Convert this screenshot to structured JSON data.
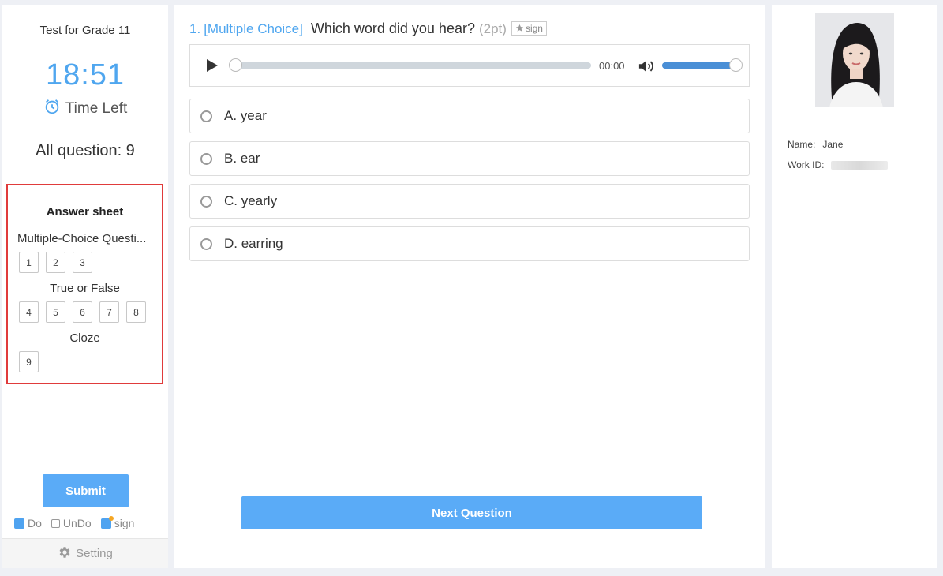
{
  "left": {
    "exam_title": "Test for Grade 11",
    "timer": "18:51",
    "time_left_label": "Time Left",
    "all_questions": "All question: 9",
    "answer_sheet": {
      "title": "Answer sheet",
      "sections": [
        {
          "label": "Multiple-Choice Questi...",
          "questions": [
            "1",
            "2",
            "3"
          ]
        },
        {
          "label": "True or False",
          "questions": [
            "4",
            "5",
            "6",
            "7",
            "8"
          ]
        },
        {
          "label": "Cloze",
          "questions": [
            "9"
          ]
        }
      ]
    },
    "submit_label": "Submit",
    "legend": {
      "do": "Do",
      "undo": "UnDo",
      "sign": "sign"
    },
    "setting_label": "Setting"
  },
  "question": {
    "number": "1.",
    "type": "[Multiple Choice]",
    "text": "Which word did you hear?",
    "points": "(2pt)",
    "sign_label": "sign",
    "audio": {
      "time": "00:00",
      "progress": 0,
      "volume": 1.0
    },
    "options": [
      {
        "letter": "A",
        "text": "A. year"
      },
      {
        "letter": "B",
        "text": "B. ear"
      },
      {
        "letter": "C",
        "text": "C. yearly"
      },
      {
        "letter": "D",
        "text": "D. earring"
      }
    ],
    "next_label": "Next Question"
  },
  "profile": {
    "name_label": "Name:",
    "name": "Jane",
    "work_id_label": "Work ID:"
  },
  "colors": {
    "accent": "#5aabf7",
    "timer": "#4fa6ef",
    "answer_sheet_border": "#e03b3b"
  }
}
